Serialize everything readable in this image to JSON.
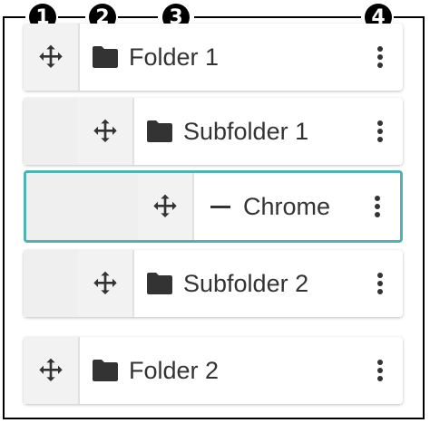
{
  "callouts": [
    "1",
    "2",
    "3",
    "4"
  ],
  "rows": [
    {
      "label": "Folder 1",
      "icon": "folder-icon",
      "level": 0,
      "selected": false
    },
    {
      "label": "Subfolder 1",
      "icon": "folder-icon",
      "level": 1,
      "selected": false
    },
    {
      "label": "Chrome",
      "icon": "dash-icon",
      "level": 2,
      "selected": true
    },
    {
      "label": "Subfolder 2",
      "icon": "folder-icon",
      "level": 1,
      "selected": false
    },
    {
      "label": "Folder 2",
      "icon": "folder-icon",
      "level": 0,
      "selected": false
    }
  ],
  "colors": {
    "selection_border": "#4fb3b3",
    "text": "#333333",
    "handle_bg": "#f2f2f2"
  }
}
